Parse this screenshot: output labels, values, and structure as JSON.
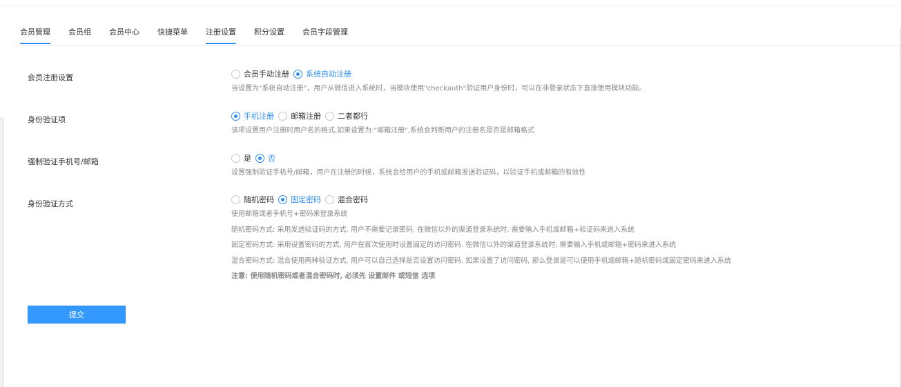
{
  "tabs": [
    {
      "label": "会员管理",
      "active": true
    },
    {
      "label": "会员组",
      "active": false
    },
    {
      "label": "会员中心",
      "active": false
    },
    {
      "label": "快捷菜单",
      "active": false
    },
    {
      "label": "注册设置",
      "active": true
    },
    {
      "label": "积分设置",
      "active": false
    },
    {
      "label": "会员字段管理",
      "active": false
    }
  ],
  "settings": {
    "register": {
      "label": "会员注册设置",
      "options": [
        {
          "label": "会员手动注册",
          "checked": false
        },
        {
          "label": "系统自动注册",
          "checked": true
        }
      ],
      "help": "当设置为\"系统自动注册\"，用户从微信进入系统时，当模块使用\"checkauth\"验证用户身份时，可以在非登录状态下直接使用模块功能。"
    },
    "identity_item": {
      "label": "身份验证项",
      "options": [
        {
          "label": "手机注册",
          "checked": true
        },
        {
          "label": "邮箱注册",
          "checked": false
        },
        {
          "label": "二者都行",
          "checked": false
        }
      ],
      "help": "该项设置用户注册时用户名的格式,如果设置为:\"邮箱注册\",系统会判断用户的注册名是否是邮箱格式"
    },
    "force_verify": {
      "label": "强制验证手机号/邮箱",
      "options": [
        {
          "label": "是",
          "checked": false
        },
        {
          "label": "否",
          "checked": true
        }
      ],
      "help": "设置强制验证手机号/邮箱，用户在注册的时候，系统会给用户的手机或邮箱发送验证码，以验证手机或邮箱的有效性"
    },
    "verify_method": {
      "label": "身份验证方式",
      "options": [
        {
          "label": "随机密码",
          "checked": false
        },
        {
          "label": "固定密码",
          "checked": true
        },
        {
          "label": "混合密码",
          "checked": false
        }
      ],
      "help_lines": [
        "使用邮箱或者手机号+密码来登录系统",
        "随机密码方式: 采用发送验证码的方式, 用户不需要记录密码. 在微信以外的渠道登录系统时, 需要输入手机或邮箱+验证码来进入系统",
        "固定密码方式: 采用设置密码的方式, 用户在首次使用时设置固定的访问密码. 在微信以外的渠道登录系统时, 需要输入手机或邮箱+密码来进入系统",
        "混合密码方式: 混合使用两种验证方式, 用户可以自己选择是否设置访问密码. 如果设置了访问密码, 那么登录是可以使用手机或邮箱+随机密码或固定密码来进入系统"
      ],
      "note": "注意: 使用随机密码或者混合密码时, 必须先 设置邮件 或短信 选项"
    }
  },
  "submit_label": "提交",
  "colors": {
    "accent": "#2d8cf0",
    "button": "#3399ff"
  }
}
